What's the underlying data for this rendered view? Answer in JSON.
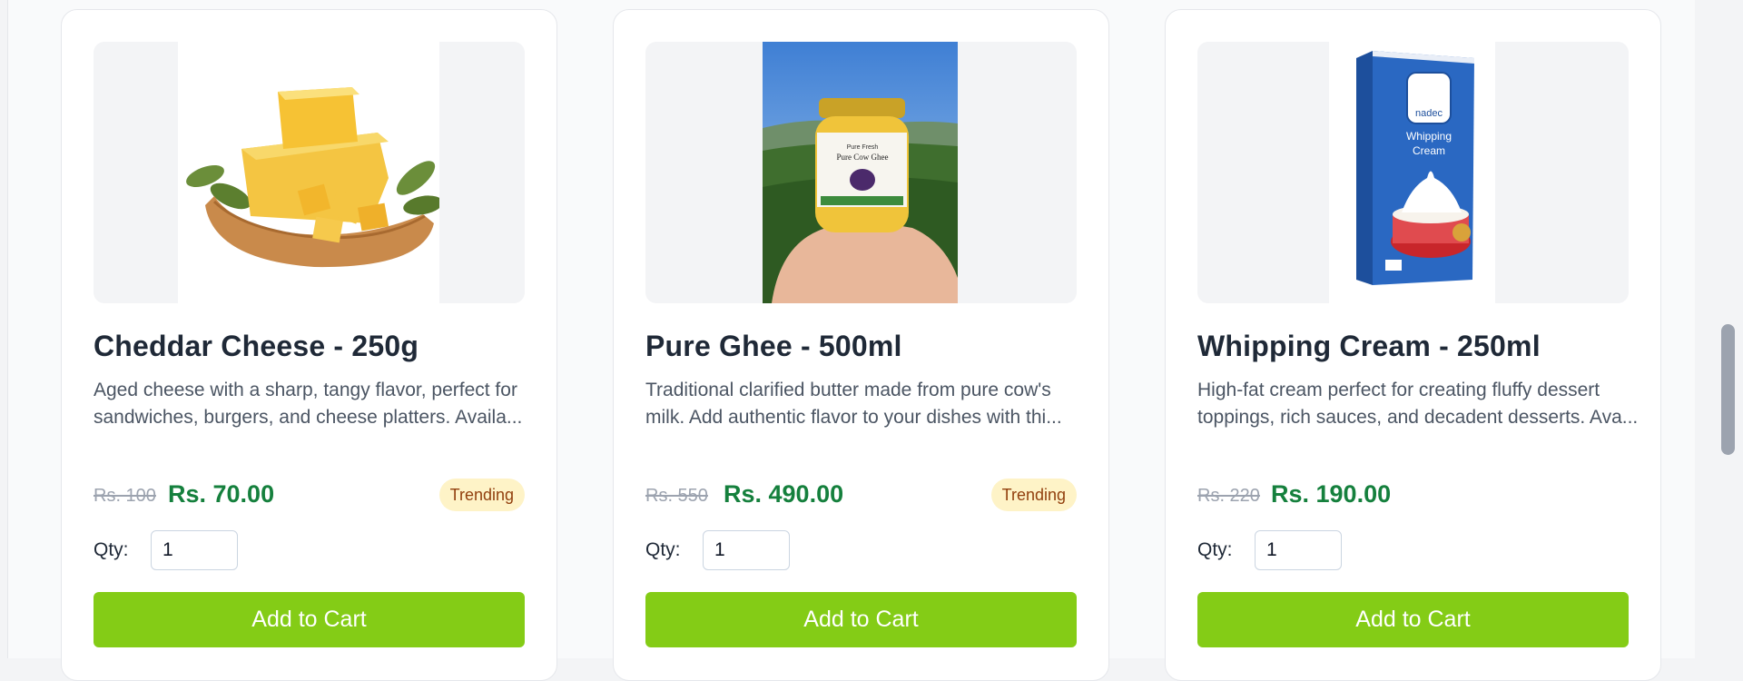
{
  "products": [
    {
      "title": "Cheddar Cheese - 250g",
      "description": "Aged cheese with a sharp, tangy flavor, perfect for sandwiches, burgers, and cheese platters. Availa...",
      "old_price": "Rs. 100",
      "price": "Rs. 70.00",
      "badge": "Trending",
      "qty_label": "Qty:",
      "qty_value": "1",
      "cart_label": "Add to Cart",
      "image_icon": "cheddar-cheese-photo"
    },
    {
      "title": "Pure Ghee - 500ml",
      "description": "Traditional clarified butter made from pure cow's milk. Add authentic flavor to your dishes with thi...",
      "old_price": "Rs. 550",
      "price": "Rs. 490.00",
      "badge": "Trending",
      "qty_label": "Qty:",
      "qty_value": "1",
      "cart_label": "Add to Cart",
      "image_icon": "ghee-jar-photo",
      "image_text": [
        "Pure Fresh",
        "Pure Cow Ghee"
      ]
    },
    {
      "title": "Whipping Cream - 250ml",
      "description": "High-fat cream perfect for creating fluffy dessert toppings, rich sauces, and decadent desserts. Ava...",
      "old_price": "Rs. 220",
      "price": "Rs. 190.00",
      "qty_label": "Qty:",
      "qty_value": "1",
      "cart_label": "Add to Cart",
      "image_icon": "whipping-cream-carton-photo",
      "image_text": [
        "nadec",
        "Whipping",
        "Cream"
      ]
    }
  ],
  "colors": {
    "accent_button": "#84cc16",
    "price_green": "#15803d",
    "badge_bg": "#fef3c7",
    "badge_text": "#92400e"
  }
}
